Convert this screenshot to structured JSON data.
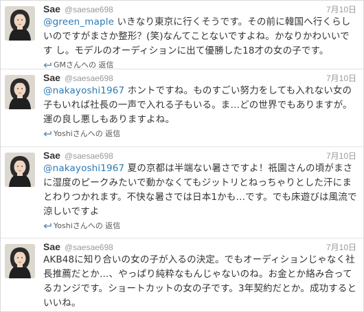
{
  "tweets": [
    {
      "name": "Sae",
      "handle": "@saesae698",
      "date": "7月10日",
      "mention": "@green_maple",
      "text": " いきなり東京に行くそうです。その前に韓国へ行くらしいのですがまさか整形？(笑)なんてことないですよね。かなりかわいいです し。モデルのオーディションに出て優勝した18才の女の子です。",
      "reply_label": "GMさんへの 返信"
    },
    {
      "name": "Sae",
      "handle": "@saesae698",
      "date": "7月10日",
      "mention": "@nakayoshi1967",
      "text": " ホントですね。ものすごい努力をしても入れない女の子もいれば社長の一声で入れる子もいる。ま…どの世界でもありますが。運の良し悪しもありますよね。",
      "reply_label": "Yoshiさんへの 返信"
    },
    {
      "name": "Sae",
      "handle": "@saesae698",
      "date": "7月10日",
      "mention": "@nakayoshi1967",
      "text": " 夏の京都は半端ない暑さですよ！祇園さんの頃がまさに湿度のピークみたいで動かなくてもジットリとねっちゃりとした汗にまとわりつかれます。不快な暑さでは日本1かも…です。でも床遊びは風流で涼しいですよ",
      "reply_label": "Yoshiさんへの 返信"
    },
    {
      "name": "Sae",
      "handle": "@saesae698",
      "date": "7月10日",
      "mention": "",
      "text": "AKB48に知り合いの女の子が入るの決定。でもオーディションじゃなく社長推薦だとか…、やっぱり純粋なもんじゃないのね。お金とか絡み合ってるカンジです。ショートカットの女の子です。3年契約だとか。成功するといいね。",
      "reply_label": ""
    }
  ],
  "colors": {
    "mention": "#2a7ab5",
    "text": "#333333",
    "meta": "#999999",
    "reply_arrow": "#6a8fb3"
  },
  "icons": {
    "avatar": "avatar",
    "reply": "reply-arrow-icon"
  }
}
